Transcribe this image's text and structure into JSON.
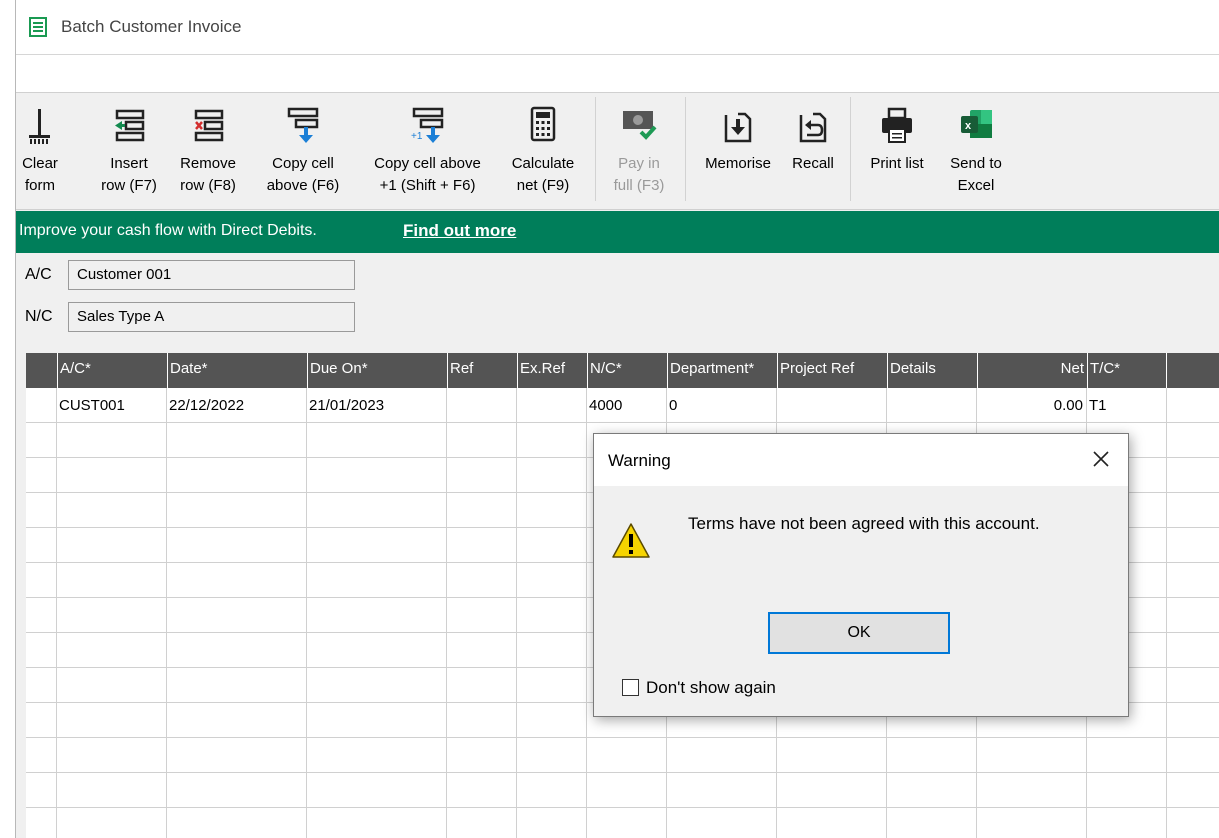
{
  "window": {
    "title": "Batch Customer Invoice",
    "icon": "ledger-book-icon"
  },
  "toolbar": {
    "tools": [
      {
        "id": "clear",
        "label": "Clear\nform",
        "icon": "broom-icon",
        "disabled": false
      },
      {
        "id": "insert",
        "label": "Insert\nrow (F7)",
        "icon": "insert-row-icon",
        "disabled": false
      },
      {
        "id": "remove",
        "label": "Remove\nrow (F8)",
        "icon": "remove-row-icon",
        "disabled": false
      },
      {
        "id": "copy",
        "label": "Copy cell\nabove (F6)",
        "icon": "copy-cell-above-icon",
        "disabled": false
      },
      {
        "id": "copyplus",
        "label": "Copy cell above\n+1 (Shift + F6)",
        "icon": "copy-cell-plus-one-icon",
        "disabled": false
      },
      {
        "id": "calc",
        "label": "Calculate\nnet (F9)",
        "icon": "calculator-icon",
        "disabled": false
      },
      {
        "id": "pay",
        "label": "Pay in\nfull (F3)",
        "icon": "banknote-check-icon",
        "disabled": true
      },
      {
        "id": "memorise",
        "label": "Memorise",
        "icon": "memorise-icon",
        "disabled": false
      },
      {
        "id": "recall",
        "label": "Recall",
        "icon": "recall-icon",
        "disabled": false
      },
      {
        "id": "print",
        "label": "Print list",
        "icon": "printer-icon",
        "disabled": false
      },
      {
        "id": "excel",
        "label": "Send to\nExcel",
        "icon": "excel-icon",
        "disabled": false
      }
    ]
  },
  "banner": {
    "text": "Improve your cash flow with Direct Debits.",
    "link": "Find out more",
    "color": "#007e5a"
  },
  "fields": {
    "ac": {
      "label": "A/C",
      "value": "Customer 001"
    },
    "nc": {
      "label": "N/C",
      "value": "Sales Type A"
    }
  },
  "grid": {
    "columns": [
      "A/C*",
      "Date*",
      "Due On*",
      "Ref",
      "Ex.Ref",
      "N/C*",
      "Department*",
      "Project Ref",
      "Details",
      "Net",
      "T/C*"
    ],
    "rows": [
      [
        "CUST001",
        "22/12/2022",
        "21/01/2023",
        "",
        "",
        "4000",
        "0",
        "",
        "",
        "0.00",
        "T1"
      ]
    ]
  },
  "dialog": {
    "title": "Warning",
    "message": "Terms have not been agreed with this account.",
    "ok_label": "OK",
    "checkbox_label": "Don't show again",
    "checkbox_checked": false,
    "icon": "warning-triangle-icon"
  }
}
